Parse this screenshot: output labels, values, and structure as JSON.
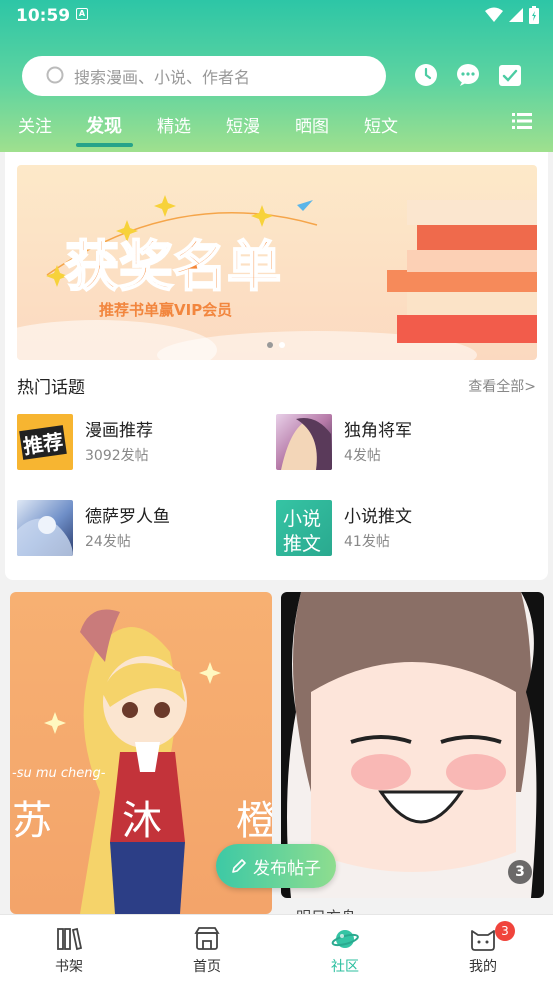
{
  "status": {
    "time": "10:59",
    "notif": "A"
  },
  "search": {
    "placeholder": "搜索漫画、小说、作者名"
  },
  "tabs": [
    {
      "label": "关注"
    },
    {
      "label": "发现"
    },
    {
      "label": "精选"
    },
    {
      "label": "短漫"
    },
    {
      "label": "晒图"
    },
    {
      "label": "短文"
    }
  ],
  "banner": {
    "title": "获奖名单",
    "subtitle": "推荐书单赢VIP会员"
  },
  "hot": {
    "title": "热门话题",
    "view_all": "查看全部>",
    "topics": [
      {
        "name": "漫画推荐",
        "count": "3092发帖",
        "thumb_text": "推荐"
      },
      {
        "name": "独角将军",
        "count": "4发帖"
      },
      {
        "name": "德萨罗人鱼",
        "count": "24发帖"
      },
      {
        "name": "小说推文",
        "count": "41发帖",
        "thumb_text_1": "小说",
        "thumb_text_2": "推文"
      }
    ]
  },
  "feed": {
    "card1": {
      "big_text_1": "苏",
      "big_text_2": "沐",
      "big_text_3": "橙",
      "small_text": "-su mu cheng-"
    },
    "card2": {
      "badge": "3",
      "caption": "明日方舟"
    }
  },
  "post_button": {
    "label": "发布帖子"
  },
  "bottom_nav": [
    {
      "label": "书架"
    },
    {
      "label": "首页"
    },
    {
      "label": "社区"
    },
    {
      "label": "我的",
      "badge": "3"
    }
  ],
  "colors": {
    "accent": "#2cbf9f",
    "badge": "#f0443c"
  }
}
